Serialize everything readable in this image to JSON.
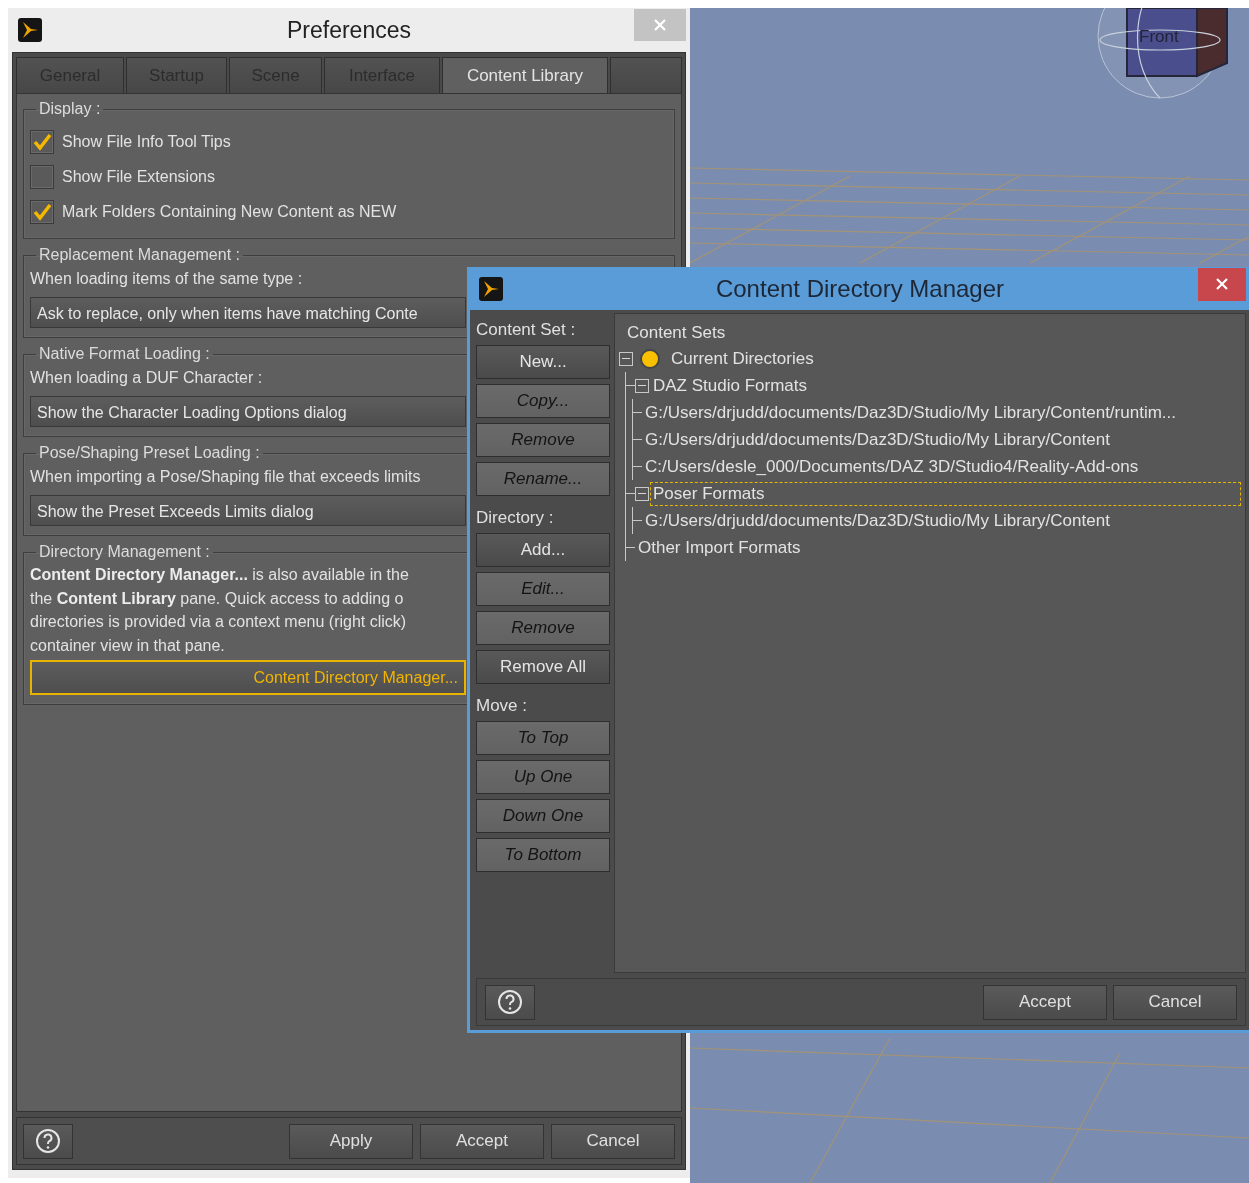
{
  "viewport": {
    "cube_label": "Front"
  },
  "preferences": {
    "title": "Preferences",
    "tabs": [
      {
        "label": "General",
        "selected": false
      },
      {
        "label": "Startup",
        "selected": false
      },
      {
        "label": "Scene",
        "selected": false
      },
      {
        "label": "Interface",
        "selected": false
      },
      {
        "label": "Content Library",
        "selected": true
      }
    ],
    "groups": [
      {
        "kind": "checks",
        "title": "Display :",
        "items": [
          {
            "label": "Show File Info Tool Tips",
            "checked": true
          },
          {
            "label": "Show File Extensions",
            "checked": false
          },
          {
            "label": "Mark Folders Containing New Content as NEW",
            "checked": true
          }
        ]
      },
      {
        "kind": "choice",
        "title": "Replacement Management :",
        "prompt": "When loading items of the same type :",
        "value": "Ask to replace, only when items have matching Conte"
      },
      {
        "kind": "choice",
        "title": "Native Format Loading :",
        "prompt": "When loading a DUF Character :",
        "value": "Show the Character Loading Options dialog"
      },
      {
        "kind": "choice",
        "title": "Pose/Shaping Preset Loading :",
        "prompt": "When importing a Pose/Shaping file that exceeds limits",
        "value": "Show the Preset Exceeds Limits dialog"
      },
      {
        "kind": "info",
        "title": "Directory Management :",
        "lines": [
          "**Content Directory Manager...** is also available in the",
          "the **Content Library** pane. Quick access to adding o",
          "directories is provided via a context menu (right click)",
          "container view in that pane."
        ],
        "button": "Content Directory Manager..."
      }
    ],
    "buttons": [
      "Apply",
      "Accept",
      "Cancel"
    ]
  },
  "content_directory_manager": {
    "title": "Content Directory Manager",
    "sidebar": [
      {
        "kind": "label",
        "text": "Content Set :"
      },
      {
        "kind": "button",
        "text": "New...",
        "disabled": false
      },
      {
        "kind": "button",
        "text": "Copy...",
        "disabled": true
      },
      {
        "kind": "button",
        "text": "Remove",
        "disabled": true
      },
      {
        "kind": "button",
        "text": "Rename...",
        "disabled": true
      },
      {
        "kind": "label",
        "text": "Directory :"
      },
      {
        "kind": "button",
        "text": "Add...",
        "disabled": false
      },
      {
        "kind": "button",
        "text": "Edit...",
        "disabled": true
      },
      {
        "kind": "button",
        "text": "Remove",
        "disabled": true
      },
      {
        "kind": "button",
        "text": "Remove All",
        "disabled": false
      },
      {
        "kind": "label",
        "text": "Move :"
      },
      {
        "kind": "button",
        "text": "To Top",
        "disabled": true
      },
      {
        "kind": "button",
        "text": "Up One",
        "disabled": true
      },
      {
        "kind": "button",
        "text": "Down One",
        "disabled": true
      },
      {
        "kind": "button",
        "text": "To Bottom",
        "disabled": true
      }
    ],
    "tree": {
      "header": "Content Sets",
      "items": [
        {
          "label": "Current Directories",
          "expanded": true,
          "current": true,
          "focused": false,
          "children": [
            {
              "label": "DAZ Studio Formats",
              "expanded": true,
              "focused": false,
              "children": [
                {
                  "label": "G:/Users/drjudd/documents/Daz3D/Studio/My Library/Content/runtim...",
                  "focused": false
                },
                {
                  "label": "G:/Users/drjudd/documents/Daz3D/Studio/My Library/Content",
                  "focused": false
                },
                {
                  "label": "C:/Users/desle_000/Documents/DAZ 3D/Studio4/Reality-Add-ons",
                  "focused": false
                }
              ]
            },
            {
              "label": "Poser Formats",
              "expanded": true,
              "focused": true,
              "children": [
                {
                  "label": "G:/Users/drjudd/documents/Daz3D/Studio/My Library/Content",
                  "focused": false
                }
              ]
            },
            {
              "label": "Other Import Formats",
              "focused": false
            }
          ]
        }
      ]
    },
    "buttons": [
      "Accept",
      "Cancel"
    ]
  }
}
